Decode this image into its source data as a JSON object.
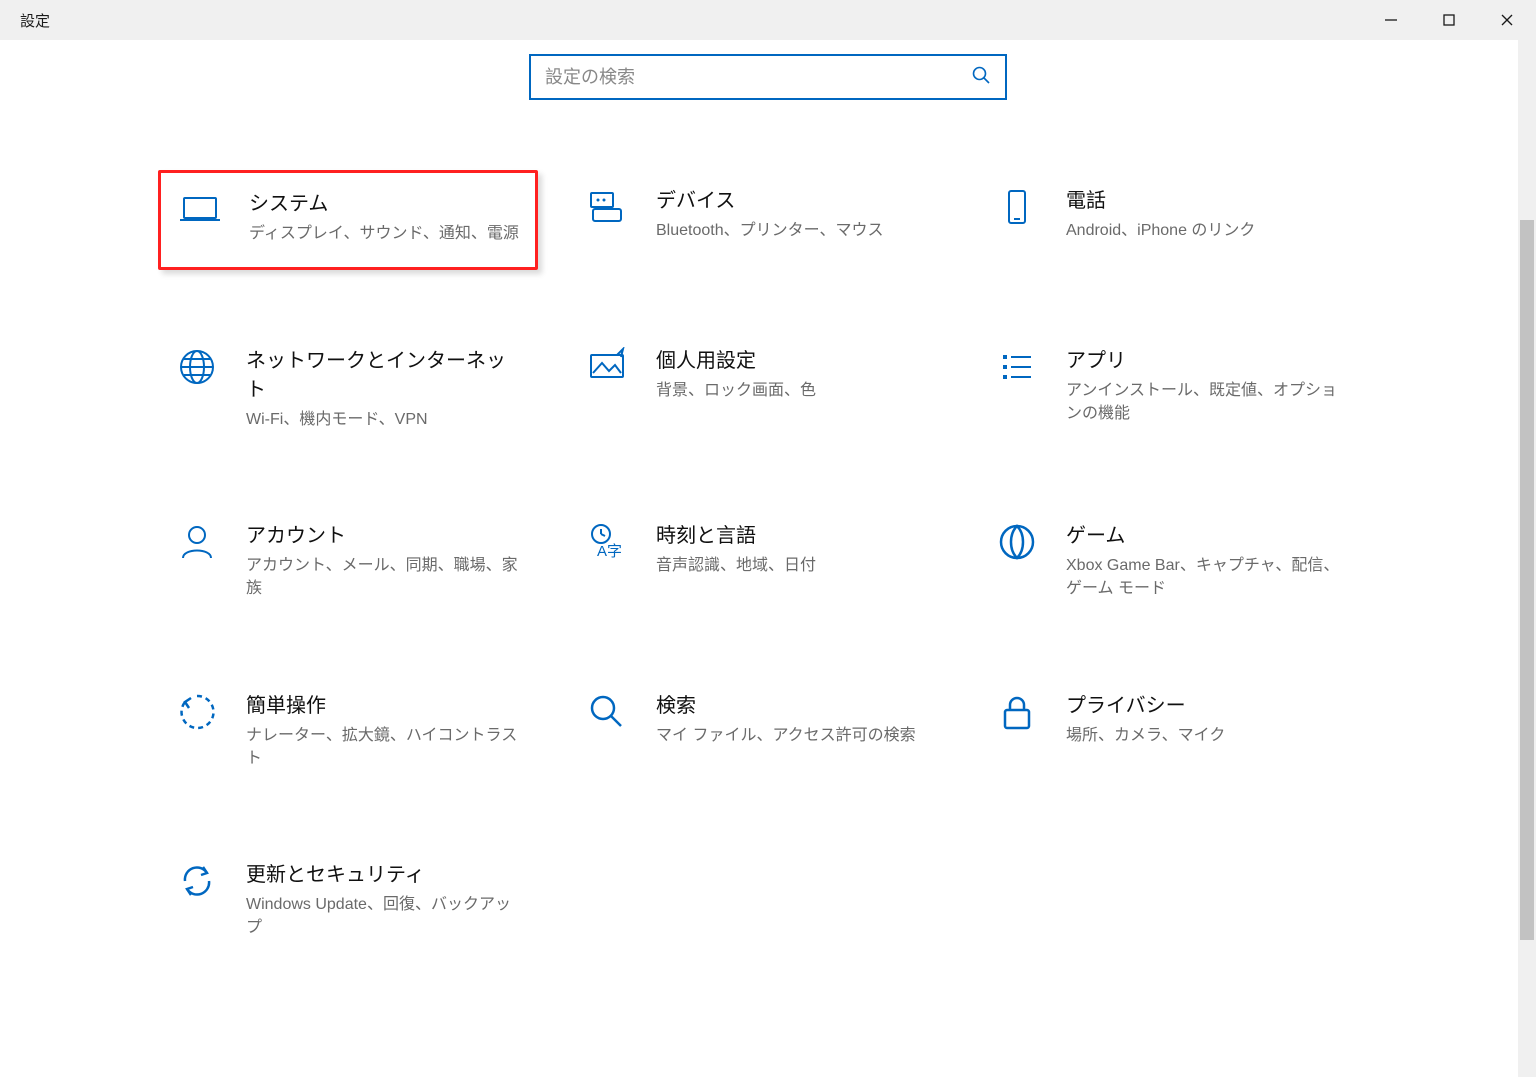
{
  "window": {
    "title": "設定"
  },
  "search": {
    "placeholder": "設定の検索"
  },
  "accent": "#0067c0",
  "cards": {
    "system": {
      "title": "システム",
      "desc": "ディスプレイ、サウンド、通知、電源"
    },
    "devices": {
      "title": "デバイス",
      "desc": "Bluetooth、プリンター、マウス"
    },
    "phone": {
      "title": "電話",
      "desc": "Android、iPhone のリンク"
    },
    "network": {
      "title": "ネットワークとインターネット",
      "desc": "Wi-Fi、機内モード、VPN"
    },
    "personal": {
      "title": "個人用設定",
      "desc": "背景、ロック画面、色"
    },
    "apps": {
      "title": "アプリ",
      "desc": "アンインストール、既定値、オプションの機能"
    },
    "accounts": {
      "title": "アカウント",
      "desc": "アカウント、メール、同期、職場、家族"
    },
    "time": {
      "title": "時刻と言語",
      "desc": "音声認識、地域、日付"
    },
    "gaming": {
      "title": "ゲーム",
      "desc": "Xbox Game Bar、キャプチャ、配信、ゲーム モード"
    },
    "ease": {
      "title": "簡単操作",
      "desc": "ナレーター、拡大鏡、ハイコントラスト"
    },
    "searchc": {
      "title": "検索",
      "desc": "マイ ファイル、アクセス許可の検索"
    },
    "privacy": {
      "title": "プライバシー",
      "desc": "場所、カメラ、マイク"
    },
    "update": {
      "title": "更新とセキュリティ",
      "desc": "Windows Update、回復、バックアップ"
    }
  }
}
